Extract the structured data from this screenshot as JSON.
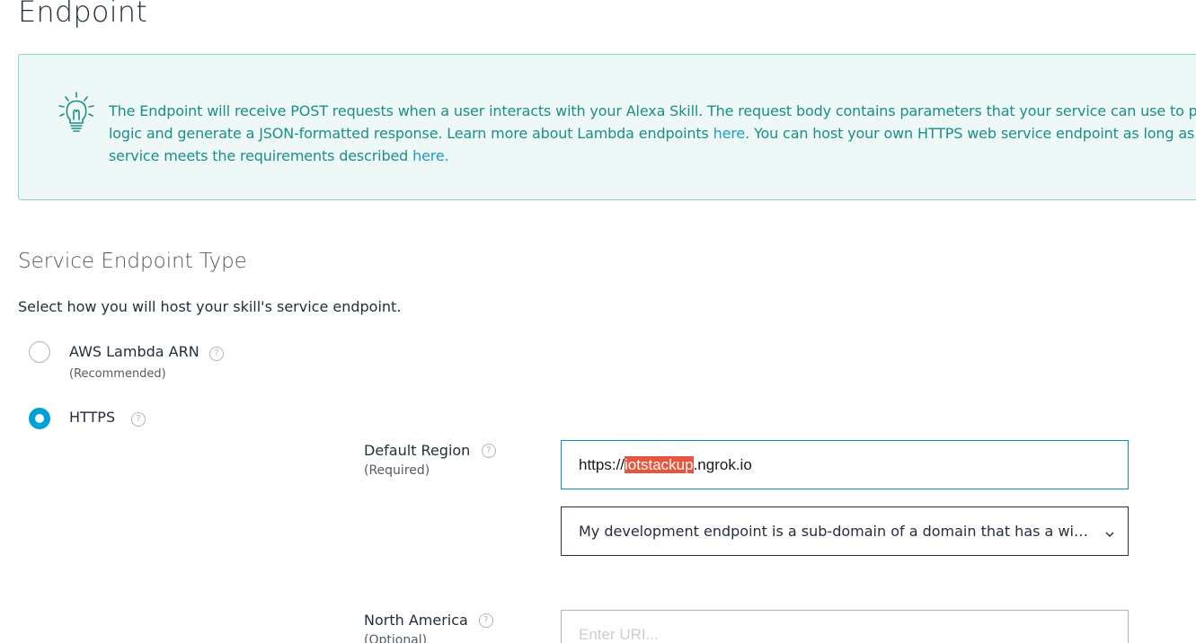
{
  "page": {
    "title": "Endpoint"
  },
  "info": {
    "icon": "lightbulb-icon",
    "line1": "The Endpoint will receive POST requests when a user interacts with your Alexa Skill. The request body contains parameters that your service can use to perform",
    "line2_before": "logic and generate a JSON-formatted response. Learn more about Lambda endpoints ",
    "line2_link": "here",
    "line2_after": ". You can host your own HTTPS web service endpoint as long as the",
    "line3_before": "service meets the requirements described ",
    "line3_link": "here.",
    "text_color": "#1a8f87",
    "link_color": "#1f9bc9"
  },
  "service_endpoint": {
    "title": "Service Endpoint Type",
    "description": "Select how you will host your skill's service endpoint.",
    "options": [
      {
        "label": "AWS Lambda ARN",
        "sublabel": "(Recommended)",
        "selected": false,
        "help": "?"
      },
      {
        "label": "HTTPS",
        "selected": true,
        "help": "?"
      }
    ],
    "accent_color": "#00a1d6"
  },
  "default_region": {
    "label": "Default Region",
    "sublabel": "(Required)",
    "help": "?",
    "url_prefix": "https://",
    "url_highlighted": "iotstackup",
    "url_suffix": ".ngrok.io",
    "certificate_option": "My development endpoint is a sub-domain of a domain that has a wildcard certificate from a certificate authority"
  },
  "north_america": {
    "label": "North America",
    "sublabel": "(Optional)",
    "help": "?",
    "placeholder": "Enter URI..."
  }
}
